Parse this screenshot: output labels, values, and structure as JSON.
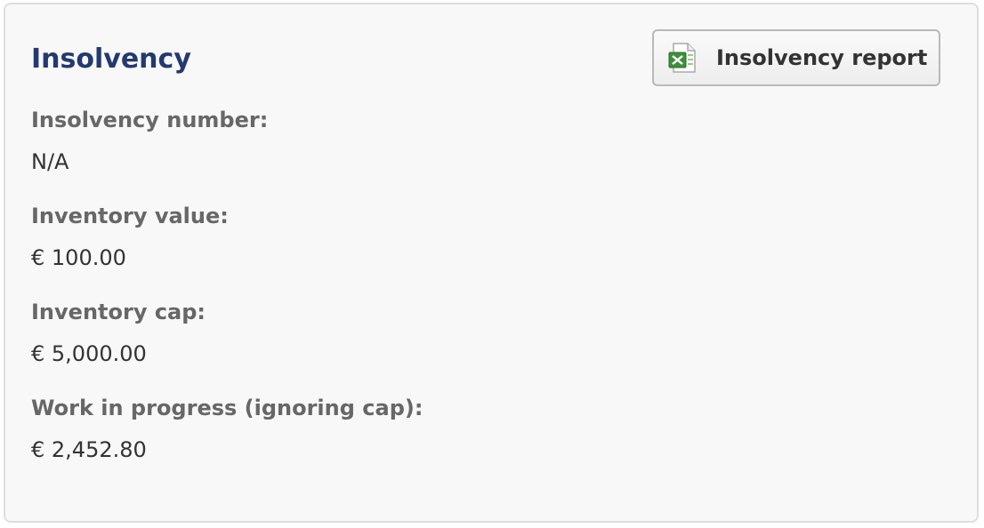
{
  "panel": {
    "title": "Insolvency",
    "report_button": {
      "label": "Insolvency report",
      "icon": "spreadsheet-icon"
    },
    "fields": [
      {
        "label": "Insolvency number:",
        "value": "N/A"
      },
      {
        "label": "Inventory value:",
        "value": "€ 100.00"
      },
      {
        "label": "Inventory cap:",
        "value": "€ 5,000.00"
      },
      {
        "label": "Work in progress (ignoring cap):",
        "value": "€ 2,452.80"
      }
    ]
  },
  "colors": {
    "title": "#23396f",
    "label": "#676767",
    "value": "#333333",
    "panel_bg": "#f8f8f8",
    "panel_border": "#dedede"
  }
}
